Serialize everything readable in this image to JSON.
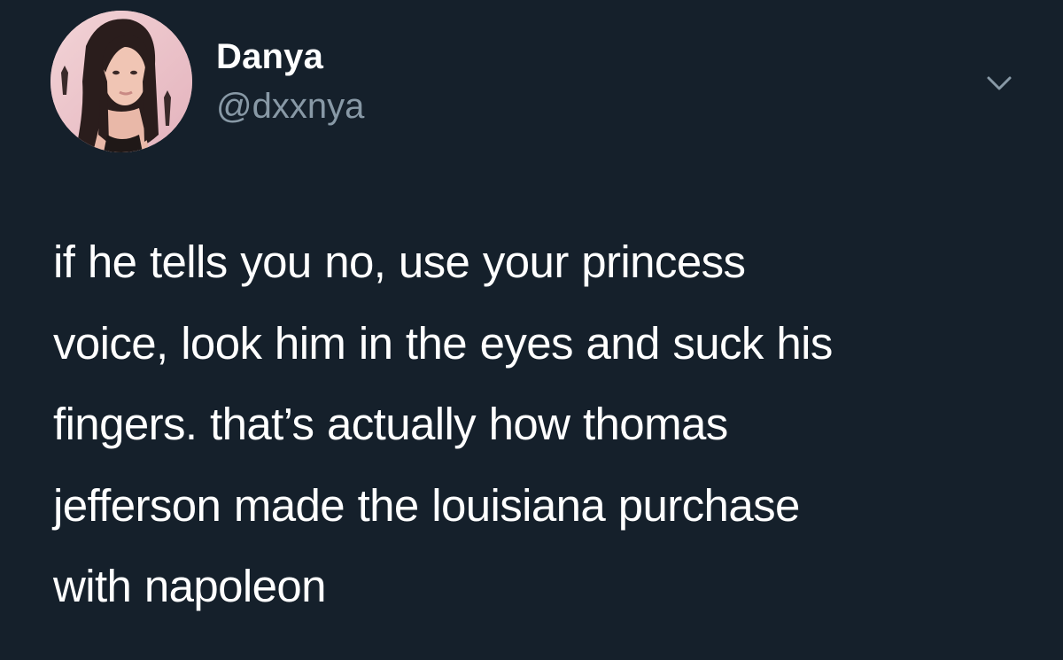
{
  "tweet": {
    "author": {
      "name": "Danya",
      "handle": "@dxxnya"
    },
    "text": "if he tells you no, use your princess\nvoice, look him in the eyes and suck his\nfingers. that’s actually how thomas\njefferson made the louisiana purchase\nwith napoleon"
  },
  "icons": {
    "menu": "chevron-down-icon"
  },
  "colors": {
    "background": "#15202b",
    "primary_text": "#ffffff",
    "secondary_text": "#8899a6"
  }
}
